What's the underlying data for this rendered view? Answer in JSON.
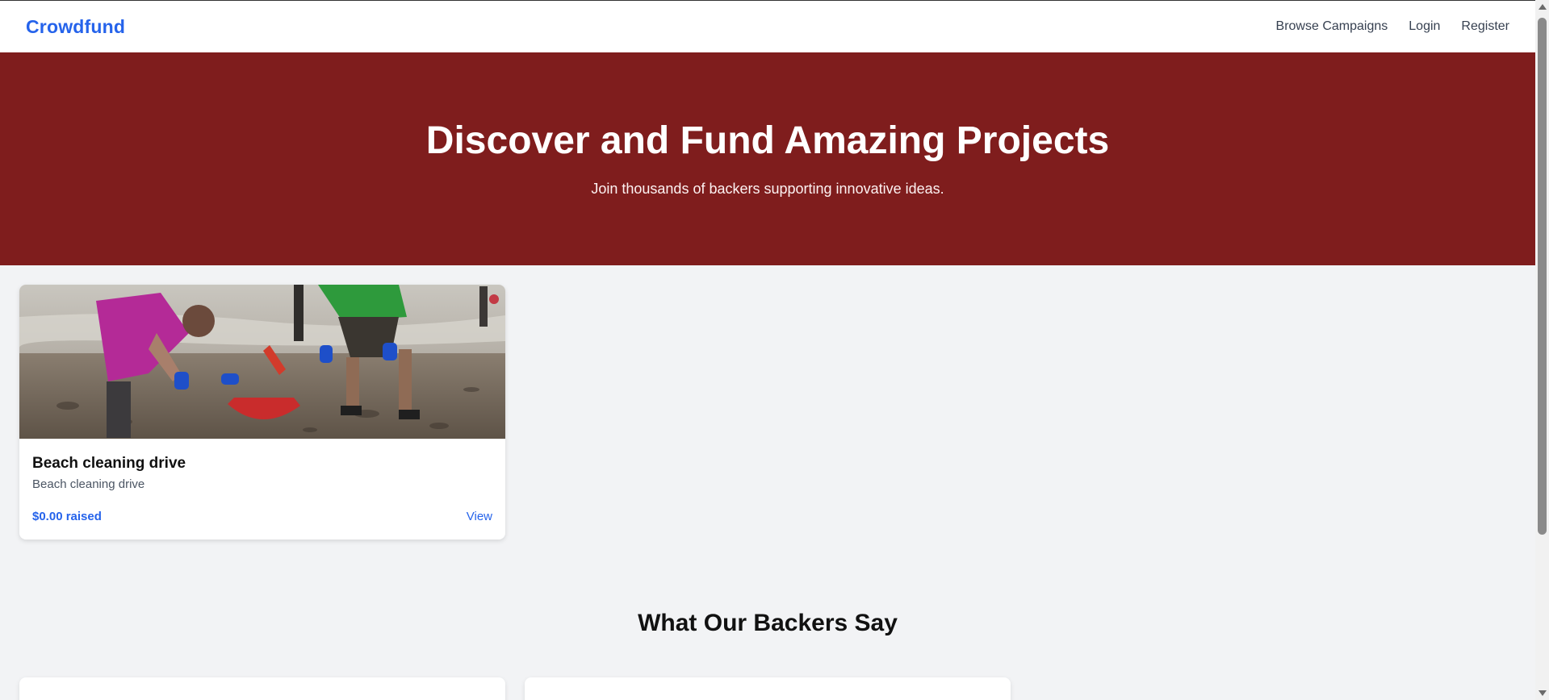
{
  "navbar": {
    "brand": "Crowdfund",
    "links": [
      "Browse Campaigns",
      "Login",
      "Register"
    ]
  },
  "hero": {
    "title": "Discover and Fund Amazing Projects",
    "subtitle": "Join thousands of backers supporting innovative ideas.",
    "background_color": "#7f1d1d"
  },
  "campaigns": [
    {
      "title": "Beach cleaning drive",
      "description": "Beach cleaning drive",
      "raised": "$0.00 raised",
      "view_label": "View"
    }
  ],
  "testimonials": {
    "title": "What Our Backers Say"
  },
  "colors": {
    "accent": "#2563eb",
    "page_background": "#f2f3f5"
  }
}
